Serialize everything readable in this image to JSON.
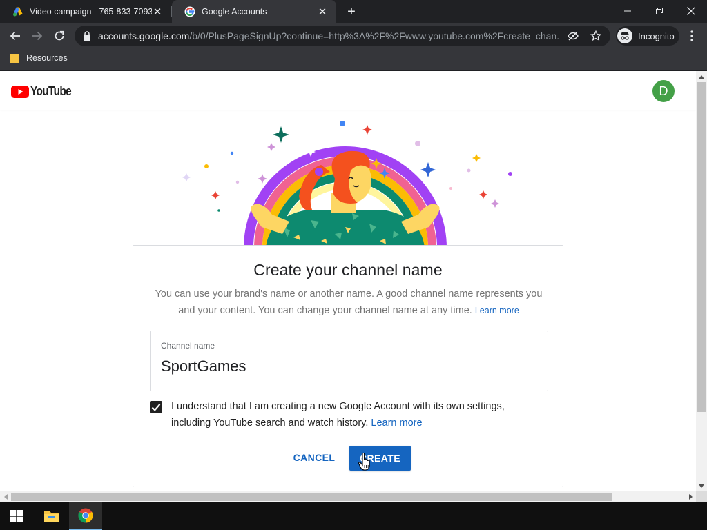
{
  "browser": {
    "tabs": [
      {
        "title": "Video campaign - 765-833-7093",
        "icon": "google-ads-icon",
        "active": false
      },
      {
        "title": "Google Accounts",
        "icon": "google-g-icon",
        "active": true
      }
    ],
    "url_host": "accounts.google.com",
    "url_path": "/b/0/PlusPageSignUp?continue=http%3A%2F%2Fwww.youtube.com%2Fcreate_chan...",
    "profile_label": "Incognito",
    "bookmarks": [
      {
        "label": "Resources",
        "icon": "folder-icon"
      }
    ]
  },
  "page": {
    "logo_text": "YouTube",
    "avatar_letter": "D",
    "avatar_color": "#43a047",
    "card": {
      "title": "Create your channel name",
      "description": "You can use your brand's name or another name. A good channel name represents you and your content. You can change your channel name at any time.",
      "learn_more_small": "Learn more",
      "field_label": "Channel name",
      "field_value": "SportGames",
      "checkbox_checked": true,
      "ack_text": "I understand that I am creating a new Google Account with its own settings, including YouTube search and watch history.",
      "ack_link": "Learn more",
      "cancel_label": "CANCEL",
      "create_label": "CREATE"
    }
  },
  "colors": {
    "accent_blue": "#1565c0",
    "youtube_red": "#ff0000",
    "chrome_dark": "#202124",
    "chrome_toolbar": "#35363a"
  }
}
